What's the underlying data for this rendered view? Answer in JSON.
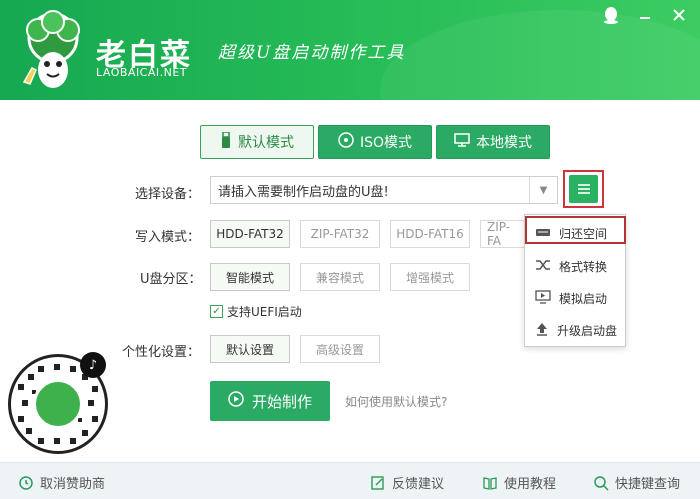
{
  "header": {
    "title": "老白菜",
    "url": "LAOBAICAI.NET",
    "slogan": "超级U盘启动制作工具"
  },
  "modes": [
    {
      "label": "默认模式",
      "icon": "usb-icon"
    },
    {
      "label": "ISO模式",
      "icon": "disc-icon"
    },
    {
      "label": "本地模式",
      "icon": "monitor-icon"
    }
  ],
  "device": {
    "label": "选择设备：",
    "value": "请插入需要制作启动盘的U盘!"
  },
  "write_mode": {
    "label": "写入模式：",
    "options": [
      "HDD-FAT32",
      "ZIP-FAT32",
      "HDD-FAT16",
      "ZIP-FA"
    ]
  },
  "partition": {
    "label": "U盘分区：",
    "options": [
      "智能模式",
      "兼容模式",
      "增强模式"
    ]
  },
  "uefi": {
    "label": "支持UEFI启动",
    "checked": true
  },
  "personalize": {
    "label": "个性化设置：",
    "options": [
      "默认设置",
      "高级设置"
    ]
  },
  "start_button": "开始制作",
  "help_link": "如何使用默认模式?",
  "menu": {
    "items": [
      {
        "label": "归还空间",
        "icon": "disk-icon"
      },
      {
        "label": "格式转换",
        "icon": "shuffle-icon"
      },
      {
        "label": "模拟启动",
        "icon": "monitor-play-icon"
      },
      {
        "label": "升级启动盘",
        "icon": "upload-icon"
      }
    ]
  },
  "footer": {
    "cancel_sponsor": "取消赞助商",
    "feedback": "反馈建议",
    "tutorial": "使用教程",
    "hotkey": "快捷键查询"
  },
  "colors": {
    "brand_green": "#2aaa63",
    "highlight_red": "#d0343a"
  }
}
